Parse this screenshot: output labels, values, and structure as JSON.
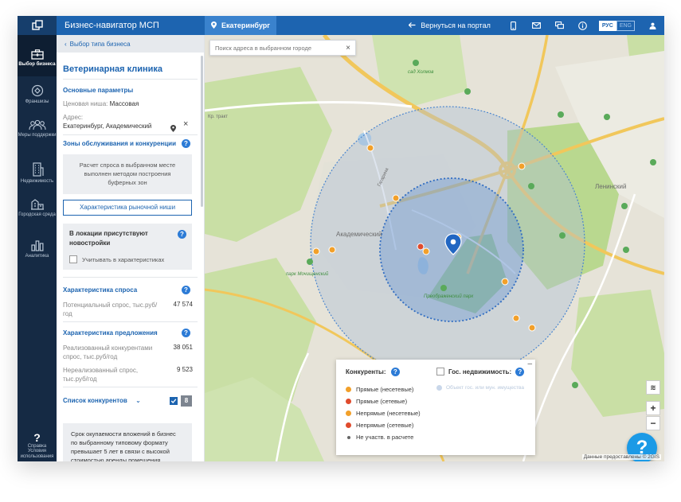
{
  "topbar": {
    "app_title": "Бизнес-навигатор МСП",
    "city": "Екатеринбург",
    "back_to_portal": "Вернуться на портал",
    "lang_ru": "РУС",
    "lang_en": "ENG"
  },
  "rail": {
    "items": [
      {
        "label": "Выбор бизнеса"
      },
      {
        "label": "Франшизы"
      },
      {
        "label": "Меры поддержки"
      },
      {
        "label": "Недвижимость"
      },
      {
        "label": "Городская среда"
      },
      {
        "label": "Аналитика"
      },
      {
        "label": "Справка"
      },
      {
        "label": "Условия использования"
      }
    ]
  },
  "panel": {
    "back_link": "Выбор типа бизнеса",
    "title": "Ветеринарная клиника",
    "main_params_title": "Основные параметры",
    "price_niche_label": "Ценовая ниша:",
    "price_niche_value": "Массовая",
    "address_label": "Адрес:",
    "address_value": "Екатеринбург, Академический",
    "zones_title": "Зоны обслуживания и конкуренции",
    "zones_info": "Расчет спроса в выбранном месте выполнен методом построения буферных зон",
    "market_button": "Характеристика рыночной ниши",
    "new_buildings_title": "В локации присутствуют новостройки",
    "new_buildings_check": "Учитывать в характеристиках",
    "demand_title": "Характеристика спроса",
    "demand_label": "Потенциальный спрос, тыс.руб/год",
    "demand_value": "47 574",
    "supply_title": "Характеристика предложения",
    "supply_realized_label": "Реализованный конкурентами спрос, тыс.руб/год",
    "supply_realized_value": "38 051",
    "supply_unrealized_label": "Нереализованный спрос, тыс.руб/год",
    "supply_unrealized_value": "9 523",
    "competitors_title": "Список конкурентов",
    "competitors_count": "8",
    "payback_text": "Срок окупаемости вложений в бизнес по выбранному типовому формату превышает 5 лет в связи с высокой стоимостью аренды помещения"
  },
  "map": {
    "search_placeholder": "Поиск адреса в выбранном городе",
    "labels": {
      "akademicheskiy": "Академический",
      "leninskiy": "Ленинский",
      "sad_kholmov": "сад Холмов",
      "park_moch": "парк Мочищенский",
      "preobr_park": "Преображенский парк",
      "gagarina": "Гагарина",
      "kr_trakt": "Кр. тракт"
    },
    "attribution": "Данные предоставлены © 2GIS"
  },
  "legend": {
    "competitors_title": "Конкуренты:",
    "state_title": "Гос. недвижимость:",
    "state_item": "Объект гос. или мун. имущества",
    "items": [
      {
        "label": "Прямые (несетевые)",
        "color": "#f2a02a"
      },
      {
        "label": "Прямые (сетевые)",
        "color": "#e04b2d"
      },
      {
        "label": "Непрямые (несетевые)",
        "color": "#f2a02a"
      },
      {
        "label": "Непрямые (сетевые)",
        "color": "#e04b2d"
      },
      {
        "label": "Не участв. в расчете",
        "color": "#666666"
      }
    ]
  },
  "colors": {
    "brand": "#1d64b0",
    "rail": "#152a44",
    "fab": "#1b9ae6"
  }
}
